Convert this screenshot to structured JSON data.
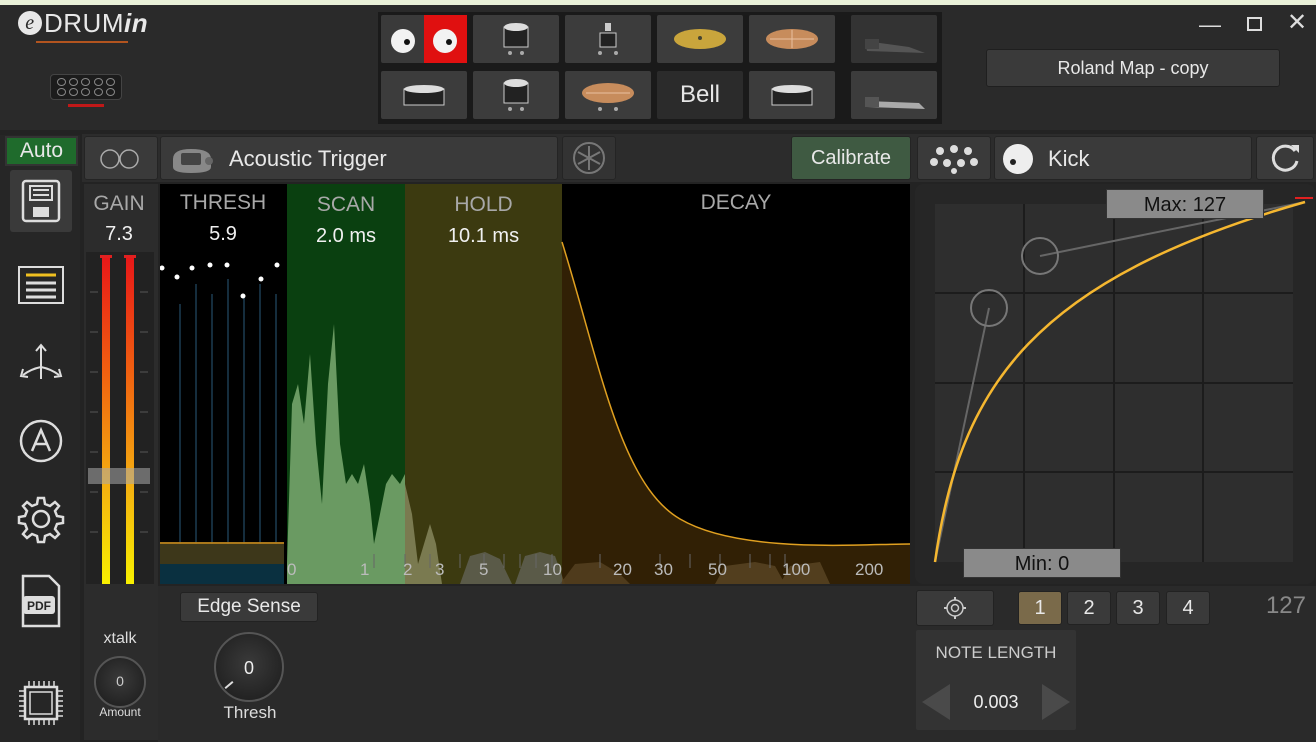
{
  "app": {
    "logo_prefix": "e",
    "logo_main": "DRUM",
    "logo_suffix": "in"
  },
  "window": {
    "minimize": "—",
    "close": "✕"
  },
  "header": {
    "map_button": "Roland Map - copy",
    "pads": [
      {
        "icon": "eyes-icon",
        "label": ""
      },
      {
        "icon": "tom-icon",
        "label": ""
      },
      {
        "icon": "kick-icon",
        "label": ""
      },
      {
        "icon": "ride-cymbal-icon",
        "label": ""
      },
      {
        "icon": "crash-cymbal-icon",
        "label": ""
      },
      {
        "icon": "pedal-open-icon",
        "label": ""
      },
      {
        "icon": "snare-icon",
        "label": ""
      },
      {
        "icon": "tom-icon",
        "label": ""
      },
      {
        "icon": "hihat-cymbal-icon",
        "label": ""
      },
      {
        "icon": "",
        "label": "Bell"
      },
      {
        "icon": "snare-icon",
        "label": ""
      },
      {
        "icon": "pedal-closed-icon",
        "label": ""
      }
    ]
  },
  "sidebar": {
    "auto": "Auto",
    "items": [
      "save-icon",
      "list-icon",
      "split-arrows-icon",
      "auto-a-icon",
      "gear-icon",
      "pdf-icon",
      "chip-icon"
    ]
  },
  "toolbar": {
    "trigger_type": "Acoustic Trigger",
    "calibrate": "Calibrate",
    "note": "Kick"
  },
  "params": {
    "gain_label": "GAIN",
    "gain_value": "7.3",
    "thresh_label": "THRESH",
    "thresh_value": "5.9",
    "scan_label": "SCAN",
    "scan_value": "2.0 ms",
    "hold_label": "HOLD",
    "hold_value": "10.1 ms",
    "decay_label": "DECAY"
  },
  "axis": {
    "ticks": [
      "0",
      "1",
      "2",
      "3",
      "5",
      "10",
      "20",
      "30",
      "50",
      "100",
      "200"
    ]
  },
  "curve": {
    "max_label": "Max: 127",
    "min_label": "Min: 0"
  },
  "bottom": {
    "edge_sense": "Edge Sense",
    "thresh_knob_value": "0",
    "thresh_knob_label": "Thresh",
    "xtalk_label": "xtalk",
    "xtalk_knob_value": "0",
    "xtalk_amount_label": "Amount",
    "layers": [
      "1",
      "2",
      "3",
      "4"
    ],
    "velocity_value": "127",
    "note_length_label": "NOTE LENGTH",
    "note_length_value": "0.003"
  },
  "colors": {
    "scan_zone": "#0a4010",
    "hold_zone": "#3c3a10",
    "decay_curve": "#e0a020",
    "curve_line": "#f5b730",
    "auto_bg": "#1f6b2c",
    "meter_red": "#e02020"
  }
}
